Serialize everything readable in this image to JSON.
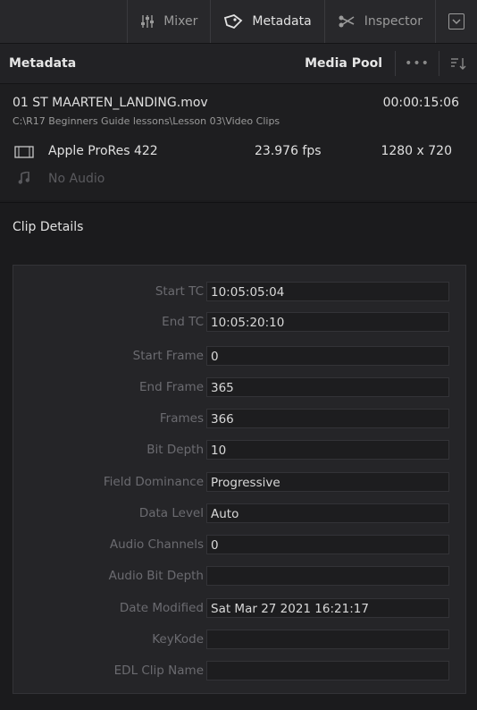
{
  "tabs": {
    "mixer": {
      "label": "Mixer",
      "icon": "mixer-icon"
    },
    "metadata": {
      "label": "Metadata",
      "icon": "metadata-tag-icon"
    },
    "inspector": {
      "label": "Inspector",
      "icon": "inspector-icon"
    },
    "toggle_icon": "chevron-down-icon"
  },
  "header": {
    "title": "Metadata",
    "media_pool": "Media Pool",
    "more": "•••",
    "sort_icon": "sort-icon"
  },
  "clip": {
    "name": "01 ST MAARTEN_LANDING.mov",
    "duration": "00:00:15:06",
    "path": "C:\\R17 Beginners Guide lessons\\Lesson 03\\Video Clips",
    "codec": "Apple ProRes 422",
    "fps": "23.976 fps",
    "resolution": "1280 x 720",
    "audio": "No Audio",
    "video_icon": "film-icon",
    "audio_icon": "music-note-icon"
  },
  "section": {
    "title": "Clip Details"
  },
  "fields": [
    {
      "label": "Start TC",
      "value": "10:05:05:04"
    },
    {
      "label": "End TC",
      "value": "10:05:20:10"
    },
    {
      "label": "Start Frame",
      "value": "0"
    },
    {
      "label": "End Frame",
      "value": "365"
    },
    {
      "label": "Frames",
      "value": "366"
    },
    {
      "label": "Bit Depth",
      "value": "10"
    },
    {
      "label": "Field Dominance",
      "value": "Progressive"
    },
    {
      "label": "Data Level",
      "value": "Auto"
    },
    {
      "label": "Audio Channels",
      "value": "0"
    },
    {
      "label": "Audio Bit Depth",
      "value": ""
    },
    {
      "label": "Date Modified",
      "value": "Sat Mar 27 2021 16:21:17"
    },
    {
      "label": "KeyKode",
      "value": ""
    },
    {
      "label": "EDL Clip Name",
      "value": ""
    }
  ],
  "colors": {
    "background": "#1b1b1d",
    "panel": "#252528",
    "text": "#d8d8d8",
    "label": "#6b6b70"
  }
}
